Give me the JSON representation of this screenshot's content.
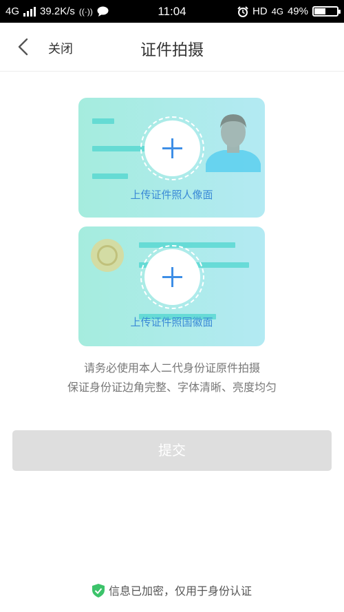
{
  "status_bar": {
    "network": "4G",
    "speed": "39.2K/s",
    "time": "11:04",
    "hd": "HD",
    "network_right": "4G",
    "battery_percent": "49%",
    "battery_level": 0.49
  },
  "header": {
    "close_label": "关闭",
    "title": "证件拍摄"
  },
  "cards": {
    "front_caption": "上传证件照人像面",
    "back_caption": "上传证件照国徽面"
  },
  "hints": [
    "请务必使用本人二代身份证原件拍摄",
    "保证身份证边角完整、字体清晰、亮度均匀"
  ],
  "submit_label": "提交",
  "footer_text": "信息已加密，仅用于身份认证",
  "colors": {
    "accent_blue": "#3d8ee6",
    "card_teal": "#a5ecde",
    "button_disabled": "#dedede",
    "shield_green": "#3cc36a"
  }
}
